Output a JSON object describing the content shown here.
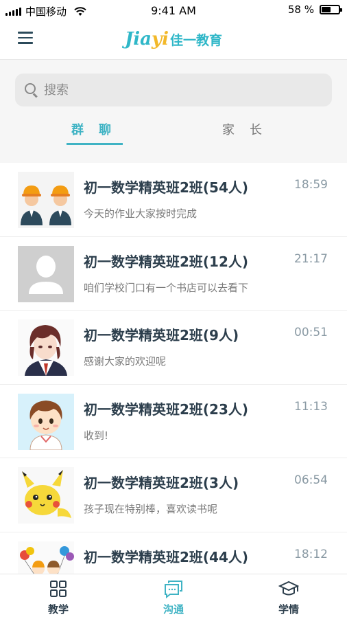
{
  "status_bar": {
    "carrier": "中国移动",
    "time": "9:41 AM",
    "battery": "58 %",
    "battery_level": 0.58
  },
  "header": {
    "logo_latin_1": "Jia",
    "logo_latin_2": "yi",
    "logo_cn": "佳一教育",
    "menu_icon": "hamburger-menu-icon"
  },
  "search": {
    "placeholder": "搜索",
    "icon": "search-icon"
  },
  "tabs": [
    {
      "label": "群聊",
      "active": true
    },
    {
      "label": "家长",
      "active": false
    }
  ],
  "colors": {
    "accent": "#3fb3c4",
    "logo_yellow": "#f2b82a",
    "title_text": "#2c3e4c"
  },
  "chats": [
    {
      "title": "初一数学精英班2班(54人)",
      "time": "18:59",
      "message": "今天的作业大家按时完成",
      "avatar": "two-workers-avatar"
    },
    {
      "title": "初一数学精英班2班(12人)",
      "time": "21:17",
      "message": "咱们学校门口有一个书店可以去看下",
      "avatar": "default-user-avatar"
    },
    {
      "title": "初一数学精英班2班(9人)",
      "time": "00:51",
      "message": "感谢大家的欢迎呢",
      "avatar": "anime-boy-avatar"
    },
    {
      "title": "初一数学精英班2班(23人)",
      "time": "11:13",
      "message": "收到!",
      "avatar": "cartoon-boy-avatar"
    },
    {
      "title": "初一数学精英班2班(3人)",
      "time": "06:54",
      "message": "孩子现在特别棒，喜欢读书呢",
      "avatar": "pikachu-avatar"
    },
    {
      "title": "初一数学精英班2班(44人)",
      "time": "18:12",
      "message": "",
      "avatar": "kids-balloons-avatar"
    }
  ],
  "bottom_nav": [
    {
      "label": "教学",
      "icon": "grid-icon",
      "active": false
    },
    {
      "label": "沟通",
      "icon": "chat-icon",
      "active": true
    },
    {
      "label": "学情",
      "icon": "graduation-cap-icon",
      "active": false
    }
  ]
}
